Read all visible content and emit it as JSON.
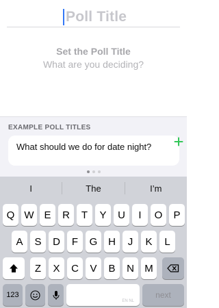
{
  "title_input": {
    "placeholder": "Poll Title"
  },
  "prompt": {
    "title": "Set the Poll Title",
    "subtitle": "What are you deciding?"
  },
  "examples": {
    "header": "EXAMPLE POLL TITLES",
    "items": [
      {
        "text": "What should we do for date night?"
      }
    ],
    "page_count": 3,
    "active_page": 1
  },
  "keyboard": {
    "suggestions": [
      "I",
      "The",
      "I’m"
    ],
    "row1": [
      "Q",
      "W",
      "E",
      "R",
      "T",
      "Y",
      "U",
      "I",
      "O",
      "P"
    ],
    "row2": [
      "A",
      "S",
      "D",
      "F",
      "G",
      "H",
      "J",
      "K",
      "L"
    ],
    "row3": [
      "Z",
      "X",
      "C",
      "V",
      "B",
      "N",
      "M"
    ],
    "numbers_label": "123",
    "space_hint": "EN NL",
    "next_label": "next"
  },
  "colors": {
    "accent": "#3478f6",
    "add_green": "#34c759"
  }
}
